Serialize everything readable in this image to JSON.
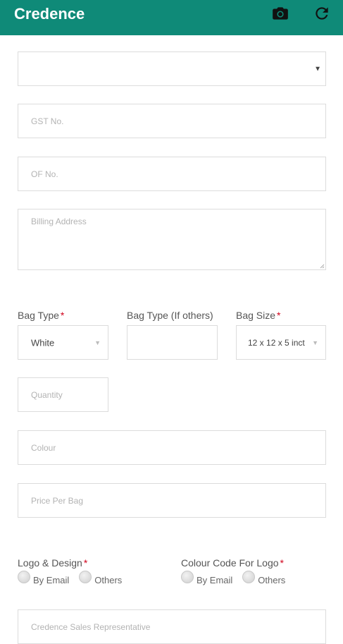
{
  "app": {
    "title": "Credence"
  },
  "form": {
    "customer_select": {
      "value": ""
    },
    "gst": {
      "placeholder": "GST No."
    },
    "of": {
      "placeholder": "OF No."
    },
    "billing": {
      "placeholder": "Billing Address"
    },
    "bag_type": {
      "label": "Bag Type",
      "required": "*",
      "value": "White"
    },
    "bag_type_other": {
      "label": "Bag Type (If others)"
    },
    "bag_size": {
      "label": "Bag Size",
      "required": "*",
      "value": "12 x 12 x 5 inct"
    },
    "quantity": {
      "placeholder": "Quantity"
    },
    "colour": {
      "placeholder": "Colour"
    },
    "price": {
      "placeholder": "Price Per Bag"
    },
    "logo_design": {
      "label": "Logo & Design",
      "required": "*",
      "options": [
        "By Email",
        "Others"
      ]
    },
    "colour_code": {
      "label": "Colour Code For Logo",
      "required": "*",
      "options": [
        "By Email",
        "Others"
      ]
    },
    "sales_rep": {
      "placeholder": "Credence Sales Representative"
    }
  },
  "icons": {
    "camera": "camera-icon",
    "refresh": "refresh-icon"
  },
  "colors": {
    "appbar": "#0f8a78",
    "required": "#d0021b"
  }
}
